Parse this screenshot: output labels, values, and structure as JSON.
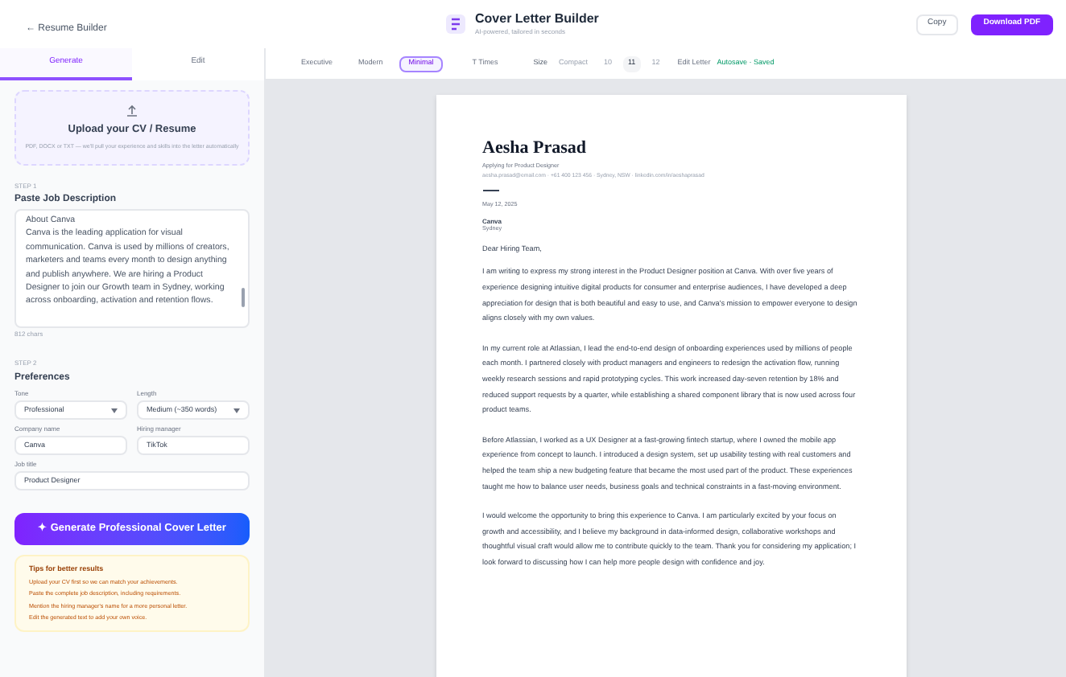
{
  "back_link": "← Resume Builder",
  "header": {
    "title": "Cover Letter Builder",
    "subtitle": "AI-powered, tailored in seconds"
  },
  "actions": [
    {
      "label": "Copy",
      "kind": "secondary"
    },
    {
      "label": "Download PDF",
      "kind": "primary"
    }
  ],
  "tabs": [
    {
      "label": "Generate",
      "selected": true
    },
    {
      "label": "Edit",
      "selected": false
    }
  ],
  "upload": {
    "title": "Upload your CV / Resume",
    "hint": "PDF, DOCX or TXT — we'll pull your experience and skills into the letter automatically"
  },
  "job": {
    "step": "STEP 1",
    "title": "Paste Job Description",
    "value": "About Canva\nCanva is the leading application for visual communication. Canva is used by millions of creators, marketers and teams every month to design anything and publish anywhere. We are hiring a Product Designer to join our Growth team in Sydney, working across onboarding, activation and retention flows.",
    "counter": "812 chars"
  },
  "preferences": {
    "step": "STEP 2",
    "title": "Preferences",
    "fields": [
      {
        "label": "Tone",
        "value": "Professional",
        "kind": "select"
      },
      {
        "label": "Length",
        "value": "Medium (~350 words)",
        "kind": "select"
      },
      {
        "label": "Company name",
        "value": "Canva",
        "kind": "input"
      },
      {
        "label": "Hiring manager",
        "value": "TikTok",
        "kind": "input"
      },
      {
        "label": "Job title",
        "value": "Product Designer",
        "kind": "input",
        "wide": true
      }
    ]
  },
  "generate_button": "✦ Generate Professional Cover Letter",
  "tips": {
    "title": "Tips for better results",
    "items": [
      "Upload your CV first so we can match your achievements.",
      "Paste the complete job description, including requirements.",
      "Mention the hiring manager's name for a more personal letter.",
      "Edit the generated text to add your own voice."
    ]
  },
  "templates": [
    {
      "label": "Executive",
      "selected": false
    },
    {
      "label": "Modern",
      "selected": false
    },
    {
      "label": "Minimal",
      "selected": true
    }
  ],
  "font": "T Times",
  "size_label": "Size",
  "sizes": [
    {
      "label": "Compact",
      "selected": false
    },
    {
      "label": "10",
      "selected": false
    },
    {
      "label": "11",
      "selected": true
    },
    {
      "label": "12",
      "selected": false
    }
  ],
  "edit_button": "Edit Letter",
  "save_status": "Autosave · Saved",
  "letter": {
    "name": "Aesha Prasad",
    "subtitle": "Applying for Product Designer",
    "contact": "aesha.prasad@email.com · +61 400 123 456 · Sydney, NSW · linkedin.com/in/aeshaprasad",
    "date": "May 12, 2025",
    "recipient": "Canva",
    "place": "Sydney",
    "greeting": "Dear Hiring Team,",
    "paragraphs": [
      "I am writing to express my strong interest in the Product Designer position at Canva. With over five years of experience designing intuitive digital products for consumer and enterprise audiences, I have developed a deep appreciation for design that is both beautiful and easy to use, and Canva's mission to empower everyone to design aligns closely with my own values.",
      "In my current role at Atlassian, I lead the end-to-end design of onboarding experiences used by millions of people each month. I partnered closely with product managers and engineers to redesign the activation flow, running weekly research sessions and rapid prototyping cycles. This work increased day-seven retention by 18% and reduced support requests by a quarter, while establishing a shared component library that is now used across four product teams.",
      "Before Atlassian, I worked as a UX Designer at a fast-growing fintech startup, where I owned the mobile app experience from concept to launch. I introduced a design system, set up usability testing with real customers and helped the team ship a new budgeting feature that became the most used part of the product. These experiences taught me how to balance user needs, business goals and technical constraints in a fast-moving environment.",
      "I would welcome the opportunity to bring this experience to Canva. I am particularly excited by your focus on growth and accessibility, and I believe my background in data-informed design, collaborative workshops and thoughtful visual craft would allow me to contribute quickly to the team. Thank you for considering my application; I look forward to discussing how I can help more people design with confidence and joy."
    ]
  }
}
